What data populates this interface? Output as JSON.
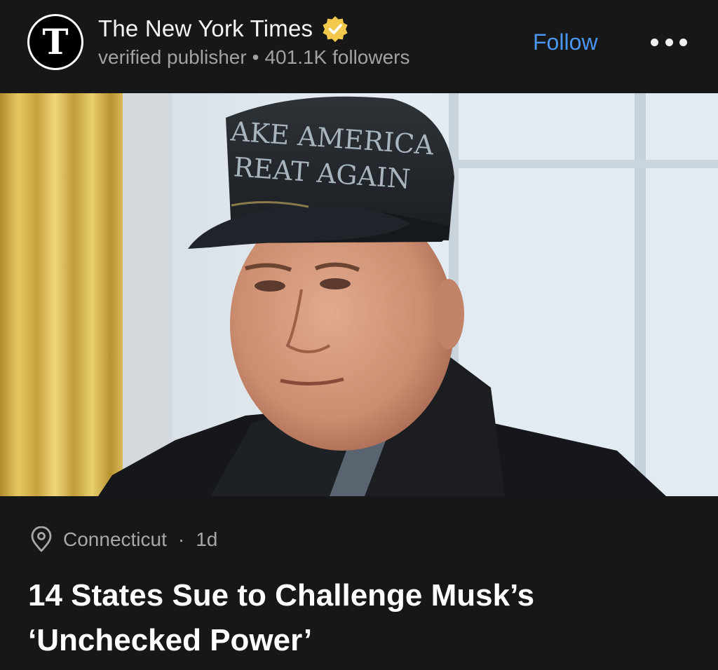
{
  "publisher": {
    "name": "The New York Times",
    "logo_letter": "T",
    "verified_icon": "verified-badge-icon",
    "badge_color": "#f2c94c",
    "subtitle": "verified publisher",
    "separator": "•",
    "followers": "401.1K followers"
  },
  "actions": {
    "follow_label": "Follow",
    "follow_color": "#4a95f0",
    "more_icon": "more-horizontal-icon"
  },
  "hero_image": {
    "cap_text_line1": "AKE AMERICA",
    "cap_text_line2": "REAT AGAIN"
  },
  "article": {
    "location_icon": "location-pin-icon",
    "location": "Connecticut",
    "separator": "·",
    "age": "1d",
    "headline": "14 States Sue to Challenge Musk’s ‘Unchecked Power’"
  }
}
